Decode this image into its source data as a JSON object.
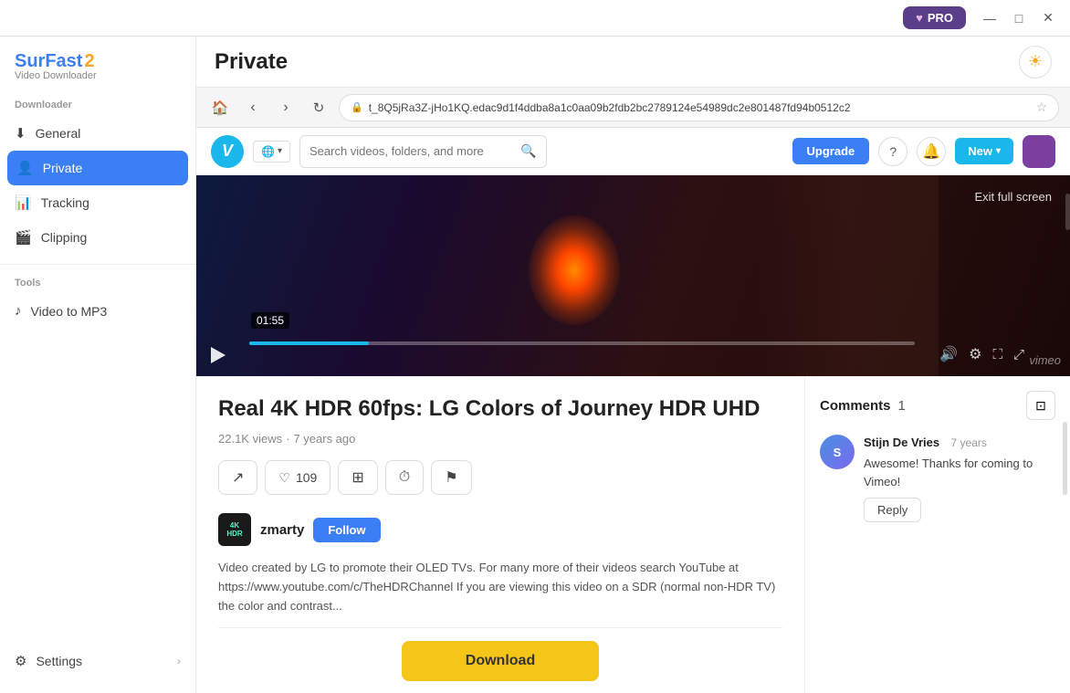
{
  "titlebar": {
    "pro_label": "PRO",
    "minimize": "—",
    "maximize": "□",
    "close": "✕"
  },
  "sidebar": {
    "logo": {
      "surfast": "SurFast",
      "number": "2",
      "subtitle": "Video Downloader"
    },
    "downloader_section": "Downloader",
    "items": [
      {
        "id": "general",
        "label": "General",
        "icon": "⬇"
      },
      {
        "id": "private",
        "label": "Private",
        "icon": "👤",
        "active": true
      },
      {
        "id": "tracking",
        "label": "Tracking",
        "icon": "📊"
      },
      {
        "id": "clipping",
        "label": "Clipping",
        "icon": "🎬"
      }
    ],
    "tools_section": "Tools",
    "tools": [
      {
        "id": "video-to-mp3",
        "label": "Video to MP3",
        "icon": "♪"
      }
    ],
    "settings": {
      "label": "Settings",
      "icon": "⚙"
    }
  },
  "header": {
    "title": "Private",
    "light_icon": "☀"
  },
  "browser": {
    "url": "t_8Q5jRa3Z-jHo1KQ.edac9d1f4ddba8a1c0aa09b2fdb2bc2789124e54989dc2e801487fd94b0512c2"
  },
  "vimeo_bar": {
    "logo": "V",
    "globe": "🌐",
    "globe_arrow": "▾",
    "search_placeholder": "Search videos, folders, and more",
    "upgrade_label": "Upgrade",
    "help": "?",
    "notification": "🔔",
    "new_label": "New",
    "new_arrow": "▾"
  },
  "video": {
    "timestamp": "01:55",
    "exit_fullscreen": "Exit full screen"
  },
  "video_info": {
    "title": "Real 4K HDR 60fps: LG Colors of Journey HDR UHD",
    "views": "22.1K views",
    "separator": "·",
    "age": "7 years ago",
    "channel_logo": "4K\nHDR",
    "channel_name": "zmarty",
    "follow_label": "Follow",
    "description": "Video created by LG to promote their OLED TVs. For many more of their videos search YouTube at https://www.youtube.com/c/TheHDRChannel\nIf you are viewing this video on a SDR (normal non-HDR TV) the color and contrast..."
  },
  "action_buttons": [
    {
      "id": "share",
      "icon": "↗",
      "label": ""
    },
    {
      "id": "like",
      "icon": "♡",
      "label": "109"
    },
    {
      "id": "layers",
      "icon": "⊞",
      "label": ""
    },
    {
      "id": "clock",
      "icon": "⏱",
      "label": ""
    },
    {
      "id": "flag",
      "icon": "⚑",
      "label": ""
    }
  ],
  "comments": {
    "title": "Comments",
    "count": "1",
    "items": [
      {
        "author": "Stijn De Vries",
        "time": "7 years",
        "text": "Awesome! Thanks for coming to Vimeo!",
        "reply_label": "Reply"
      }
    ]
  },
  "download": {
    "label": "Download"
  }
}
